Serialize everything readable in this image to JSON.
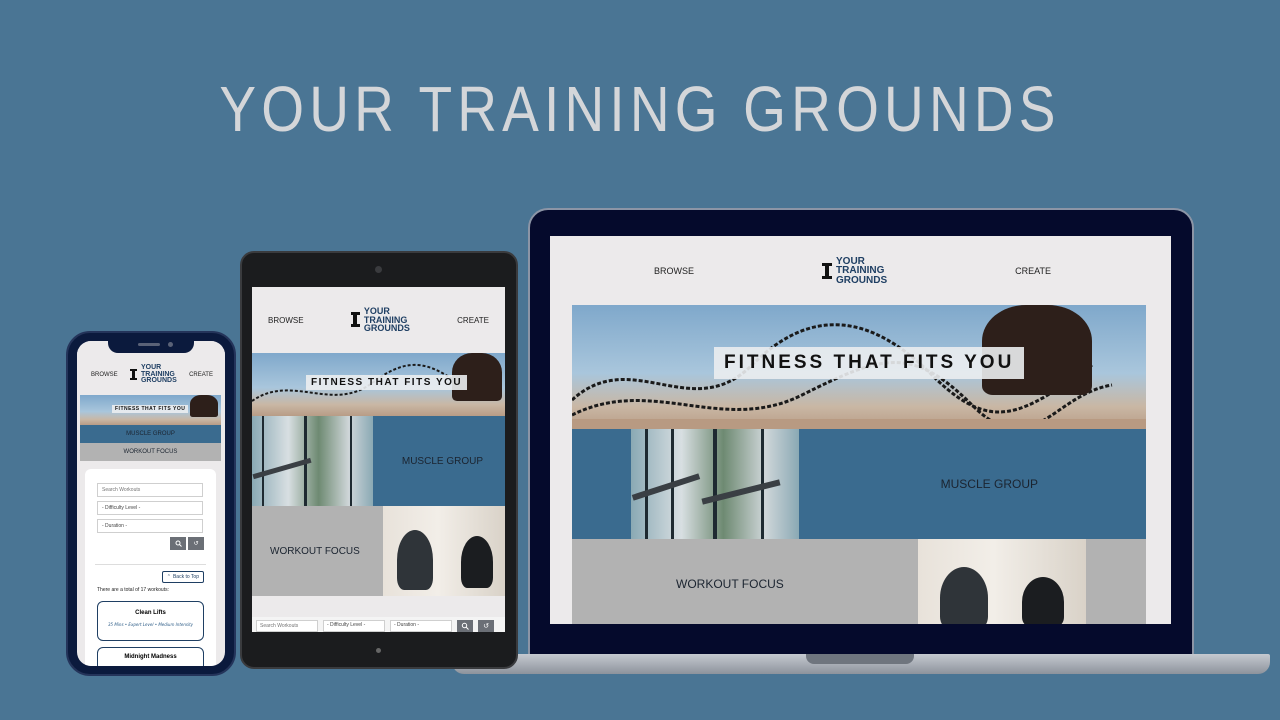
{
  "hero": {
    "title": "YOUR TRAINING GROUNDS"
  },
  "site": {
    "logo_line1": "YOUR",
    "logo_line2": "TRAINING",
    "logo_line3": "GROUNDS",
    "nav_browse": "BROWSE",
    "nav_create": "CREATE",
    "tagline": "FITNESS THAT FITS YOU",
    "card_muscle": "MUSCLE GROUP",
    "card_workout": "WORKOUT FOCUS"
  },
  "search": {
    "placeholder": "Search Workouts",
    "difficulty": "- Difficulty Level -",
    "duration": "- Duration -",
    "back_to_top": "Back to Top",
    "total_text": "There are a total of 17 workouts:"
  },
  "workouts": [
    {
      "title": "Clean Lifts",
      "meta": "35 Mins • Expert Level • Medium Intensity"
    },
    {
      "title": "Midnight Madness",
      "meta": ""
    }
  ],
  "colors": {
    "background": "#4a7594",
    "accent_blue": "#3a6b8f",
    "grey": "#b2b2b2",
    "navy": "#1f3f63"
  }
}
